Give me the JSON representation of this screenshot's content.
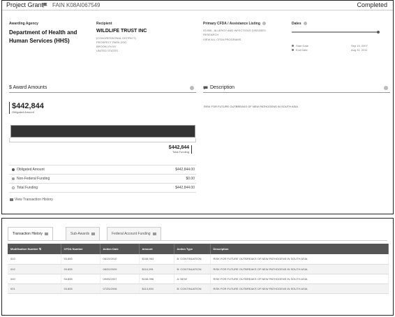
{
  "header": {
    "title": "Project Grant",
    "fain_label": "FAIN",
    "fain_value": "K08AI067549",
    "status": "Completed"
  },
  "awarding_agency": {
    "label": "Awarding Agency",
    "name_line1": "Department of Health and",
    "name_line2": "Human Services (HHS)"
  },
  "recipient": {
    "label": "Recipient",
    "name": "WILDLIFE TRUST INC",
    "lines": [
      "(CONGRESSIONAL DISTRICT)",
      "PROSPECT PARK ZOO",
      "BROOKLYN NY",
      "UNITED STATES"
    ]
  },
  "cfda": {
    "label": "Primary CFDA / Assistance Listing",
    "lines": [
      "93.855 - ALLERGY AND INFECTIOUS DISEASES",
      "RESEARCH",
      "VIEW ALL CFDA PROGRAMS"
    ]
  },
  "dates": {
    "label": "Dates",
    "start_label": "Start Date",
    "start_value": "Sep 15, 2007",
    "end_label": "End Date",
    "end_value": "Aug 31, 2011",
    "progress": 1.0
  },
  "award_amounts": {
    "section_title": "$ Award Amounts",
    "obligated_amount": "$442,844",
    "obligated_label": "Obligated Amount",
    "total_amount": "$442,844",
    "total_label": "Total Funding",
    "rows": [
      {
        "name": "Obligated Amount",
        "value": "$442,844.00",
        "color": "#555555"
      },
      {
        "name": "Non-Federal Funding",
        "value": "$0.00",
        "color": "#999999"
      },
      {
        "name": "Total Funding",
        "value": "$442,844.00",
        "color": "#ffffff"
      }
    ],
    "history_link": "View Transaction History"
  },
  "description": {
    "section_title": "Description",
    "text": "RISK FOR FUTURE OUTBREAKS OF NEW PATHOGENS IN SOUTH ASIA"
  },
  "tabs": [
    {
      "label": "Transaction History",
      "active": true
    },
    {
      "label": "Sub-Awards",
      "active": false
    },
    {
      "label": "Federal Account Funding",
      "active": false
    }
  ],
  "table": {
    "columns": [
      "Modification Number",
      "CFDA Number",
      "Action Date",
      "Amount",
      "Action Type",
      "Description"
    ],
    "rows": [
      [
        "003",
        "93.855",
        "08/19/2010",
        "$108,963",
        "B: Continuation",
        "RISK FOR FUTURE OUTBREAKS OF NEW PATHOGENS IN SOUTH ASIA"
      ],
      [
        "002",
        "93.855",
        "08/20/2009",
        "$110,991",
        "B: Continuation",
        "RISK FOR FUTURE OUTBREAKS OF NEW PATHOGENS IN SOUTH ASIA"
      ],
      [
        "000",
        "93.855",
        "09/05/2007",
        "$108,996",
        "A: New",
        "RISK FOR FUTURE OUTBREAKS OF NEW PATHOGENS IN SOUTH ASIA"
      ],
      [
        "001",
        "93.855",
        "07/25/2008",
        "$113,894",
        "B: Continuation",
        "RISK FOR FUTURE OUTBREAKS OF NEW PATHOGENS IN SOUTH ASIA"
      ]
    ]
  }
}
